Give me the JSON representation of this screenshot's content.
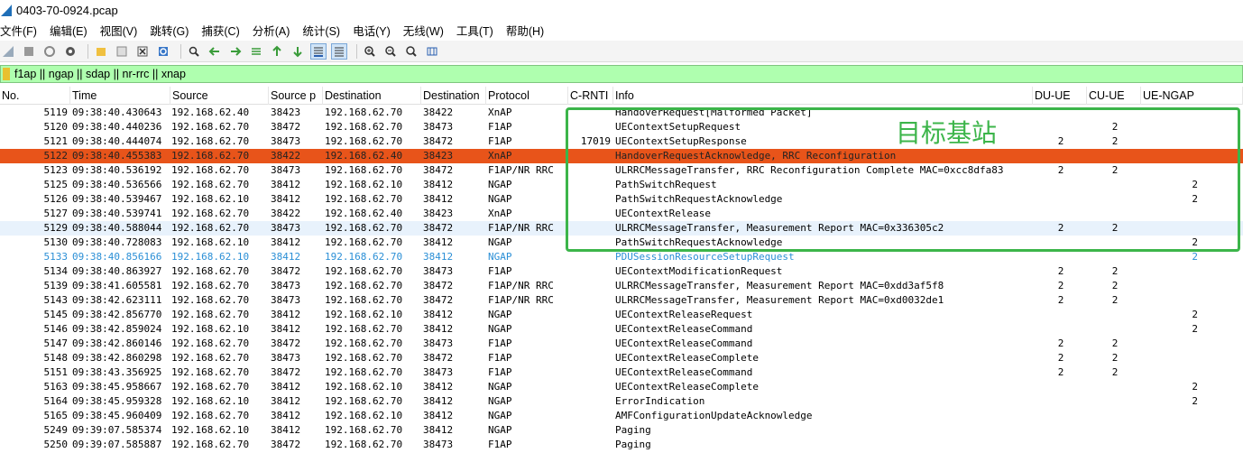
{
  "window": {
    "title": "0403-70-0924.pcap"
  },
  "menu": [
    "文件(F)",
    "编辑(E)",
    "视图(V)",
    "跳转(G)",
    "捕获(C)",
    "分析(A)",
    "统计(S)",
    "电话(Y)",
    "无线(W)",
    "工具(T)",
    "帮助(H)"
  ],
  "filter": {
    "value": "f1ap || ngap || sdap || nr-rrc || xnap"
  },
  "columns": [
    "No.",
    "Time",
    "Source",
    "Source p",
    "Destination",
    "Destination",
    "Protocol",
    "C-RNTI",
    "Info",
    "DU-UE",
    "CU-UE",
    "UE-NGAP"
  ],
  "annotation": {
    "label": "目标基站",
    "color": "#3cb54a"
  },
  "colors": {
    "error_row": "#e8541a",
    "highlight_row": "#e8f2fc",
    "filter_bg": "#afffaf",
    "blue_text": "#2b8fd6"
  },
  "packets": [
    {
      "no": "5119",
      "time": "09:38:40.430643",
      "src": "192.168.62.40",
      "sport": "38423",
      "dst": "192.168.62.70",
      "dport": "38422",
      "proto": "XnAP",
      "crnti": "",
      "info": "HandoverRequest[Malformed Packet]",
      "du": "",
      "cu": "",
      "ngap": "",
      "style": ""
    },
    {
      "no": "5120",
      "time": "09:38:40.440236",
      "src": "192.168.62.70",
      "sport": "38472",
      "dst": "192.168.62.70",
      "dport": "38473",
      "proto": "F1AP",
      "crnti": "",
      "info": "UEContextSetupRequest",
      "du": "",
      "cu": "2",
      "ngap": "",
      "style": ""
    },
    {
      "no": "5121",
      "time": "09:38:40.444074",
      "src": "192.168.62.70",
      "sport": "38473",
      "dst": "192.168.62.70",
      "dport": "38472",
      "proto": "F1AP",
      "crnti": "17019",
      "info": "UEContextSetupResponse",
      "du": "2",
      "cu": "2",
      "ngap": "",
      "style": ""
    },
    {
      "no": "5122",
      "time": "09:38:40.455383",
      "src": "192.168.62.70",
      "sport": "38422",
      "dst": "192.168.62.40",
      "dport": "38423",
      "proto": "XnAP",
      "crnti": "",
      "info": "HandoverRequestAcknowledge, RRC Reconfiguration",
      "du": "",
      "cu": "",
      "ngap": "",
      "style": "error"
    },
    {
      "no": "5123",
      "time": "09:38:40.536192",
      "src": "192.168.62.70",
      "sport": "38473",
      "dst": "192.168.62.70",
      "dport": "38472",
      "proto": "F1AP/NR RRC",
      "crnti": "",
      "info": "ULRRCMessageTransfer, RRC Reconfiguration Complete MAC=0xcc8dfa83",
      "du": "2",
      "cu": "2",
      "ngap": "",
      "style": ""
    },
    {
      "no": "5125",
      "time": "09:38:40.536566",
      "src": "192.168.62.70",
      "sport": "38412",
      "dst": "192.168.62.10",
      "dport": "38412",
      "proto": "NGAP",
      "crnti": "",
      "info": "PathSwitchRequest",
      "du": "",
      "cu": "",
      "ngap": "2",
      "style": ""
    },
    {
      "no": "5126",
      "time": "09:38:40.539467",
      "src": "192.168.62.10",
      "sport": "38412",
      "dst": "192.168.62.70",
      "dport": "38412",
      "proto": "NGAP",
      "crnti": "",
      "info": "PathSwitchRequestAcknowledge",
      "du": "",
      "cu": "",
      "ngap": "2",
      "style": ""
    },
    {
      "no": "5127",
      "time": "09:38:40.539741",
      "src": "192.168.62.70",
      "sport": "38422",
      "dst": "192.168.62.40",
      "dport": "38423",
      "proto": "XnAP",
      "crnti": "",
      "info": "UEContextRelease",
      "du": "",
      "cu": "",
      "ngap": "",
      "style": ""
    },
    {
      "no": "5129",
      "time": "09:38:40.588044",
      "src": "192.168.62.70",
      "sport": "38473",
      "dst": "192.168.62.70",
      "dport": "38472",
      "proto": "F1AP/NR RRC",
      "crnti": "",
      "info": "ULRRCMessageTransfer, Measurement Report MAC=0x336305c2",
      "du": "2",
      "cu": "2",
      "ngap": "",
      "style": "highlight"
    },
    {
      "no": "5130",
      "time": "09:38:40.728083",
      "src": "192.168.62.10",
      "sport": "38412",
      "dst": "192.168.62.70",
      "dport": "38412",
      "proto": "NGAP",
      "crnti": "",
      "info": "PathSwitchRequestAcknowledge",
      "du": "",
      "cu": "",
      "ngap": "2",
      "style": ""
    },
    {
      "no": "5133",
      "time": "09:38:40.856166",
      "src": "192.168.62.10",
      "sport": "38412",
      "dst": "192.168.62.70",
      "dport": "38412",
      "proto": "NGAP",
      "crnti": "",
      "info": "PDUSessionResourceSetupRequest",
      "du": "",
      "cu": "",
      "ngap": "2",
      "style": "blue"
    },
    {
      "no": "5134",
      "time": "09:38:40.863927",
      "src": "192.168.62.70",
      "sport": "38472",
      "dst": "192.168.62.70",
      "dport": "38473",
      "proto": "F1AP",
      "crnti": "",
      "info": "UEContextModificationRequest",
      "du": "2",
      "cu": "2",
      "ngap": "",
      "style": ""
    },
    {
      "no": "5139",
      "time": "09:38:41.605581",
      "src": "192.168.62.70",
      "sport": "38473",
      "dst": "192.168.62.70",
      "dport": "38472",
      "proto": "F1AP/NR RRC",
      "crnti": "",
      "info": "ULRRCMessageTransfer, Measurement Report MAC=0xdd3af5f8",
      "du": "2",
      "cu": "2",
      "ngap": "",
      "style": ""
    },
    {
      "no": "5143",
      "time": "09:38:42.623111",
      "src": "192.168.62.70",
      "sport": "38473",
      "dst": "192.168.62.70",
      "dport": "38472",
      "proto": "F1AP/NR RRC",
      "crnti": "",
      "info": "ULRRCMessageTransfer, Measurement Report MAC=0xd0032de1",
      "du": "2",
      "cu": "2",
      "ngap": "",
      "style": ""
    },
    {
      "no": "5145",
      "time": "09:38:42.856770",
      "src": "192.168.62.70",
      "sport": "38412",
      "dst": "192.168.62.10",
      "dport": "38412",
      "proto": "NGAP",
      "crnti": "",
      "info": "UEContextReleaseRequest",
      "du": "",
      "cu": "",
      "ngap": "2",
      "style": ""
    },
    {
      "no": "5146",
      "time": "09:38:42.859024",
      "src": "192.168.62.10",
      "sport": "38412",
      "dst": "192.168.62.70",
      "dport": "38412",
      "proto": "NGAP",
      "crnti": "",
      "info": "UEContextReleaseCommand",
      "du": "",
      "cu": "",
      "ngap": "2",
      "style": ""
    },
    {
      "no": "5147",
      "time": "09:38:42.860146",
      "src": "192.168.62.70",
      "sport": "38472",
      "dst": "192.168.62.70",
      "dport": "38473",
      "proto": "F1AP",
      "crnti": "",
      "info": "UEContextReleaseCommand",
      "du": "2",
      "cu": "2",
      "ngap": "",
      "style": ""
    },
    {
      "no": "5148",
      "time": "09:38:42.860298",
      "src": "192.168.62.70",
      "sport": "38473",
      "dst": "192.168.62.70",
      "dport": "38472",
      "proto": "F1AP",
      "crnti": "",
      "info": "UEContextReleaseComplete",
      "du": "2",
      "cu": "2",
      "ngap": "",
      "style": ""
    },
    {
      "no": "5151",
      "time": "09:38:43.356925",
      "src": "192.168.62.70",
      "sport": "38472",
      "dst": "192.168.62.70",
      "dport": "38473",
      "proto": "F1AP",
      "crnti": "",
      "info": "UEContextReleaseCommand",
      "du": "2",
      "cu": "2",
      "ngap": "",
      "style": ""
    },
    {
      "no": "5163",
      "time": "09:38:45.958667",
      "src": "192.168.62.70",
      "sport": "38412",
      "dst": "192.168.62.10",
      "dport": "38412",
      "proto": "NGAP",
      "crnti": "",
      "info": "UEContextReleaseComplete",
      "du": "",
      "cu": "",
      "ngap": "2",
      "style": ""
    },
    {
      "no": "5164",
      "time": "09:38:45.959328",
      "src": "192.168.62.10",
      "sport": "38412",
      "dst": "192.168.62.70",
      "dport": "38412",
      "proto": "NGAP",
      "crnti": "",
      "info": "ErrorIndication",
      "du": "",
      "cu": "",
      "ngap": "2",
      "style": ""
    },
    {
      "no": "5165",
      "time": "09:38:45.960409",
      "src": "192.168.62.70",
      "sport": "38412",
      "dst": "192.168.62.10",
      "dport": "38412",
      "proto": "NGAP",
      "crnti": "",
      "info": "AMFConfigurationUpdateAcknowledge",
      "du": "",
      "cu": "",
      "ngap": "",
      "style": ""
    },
    {
      "no": "5249",
      "time": "09:39:07.585374",
      "src": "192.168.62.10",
      "sport": "38412",
      "dst": "192.168.62.70",
      "dport": "38412",
      "proto": "NGAP",
      "crnti": "",
      "info": "Paging",
      "du": "",
      "cu": "",
      "ngap": "",
      "style": ""
    },
    {
      "no": "5250",
      "time": "09:39:07.585887",
      "src": "192.168.62.70",
      "sport": "38472",
      "dst": "192.168.62.70",
      "dport": "38473",
      "proto": "F1AP",
      "crnti": "",
      "info": "Paging",
      "du": "",
      "cu": "",
      "ngap": "",
      "style": ""
    }
  ]
}
